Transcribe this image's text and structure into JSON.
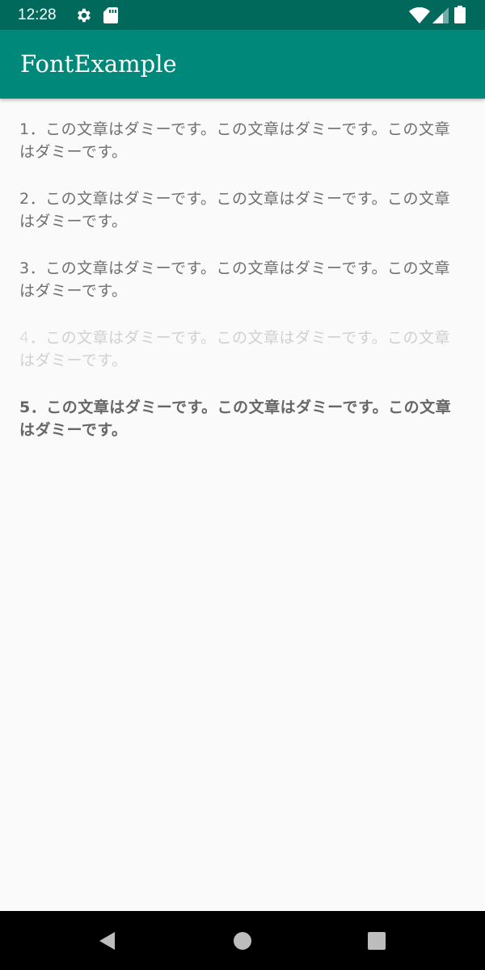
{
  "status_bar": {
    "time": "12:28",
    "icons": [
      "gear-icon",
      "sd-card-icon",
      "wifi-icon",
      "signal-icon",
      "battery-icon"
    ]
  },
  "app_bar": {
    "title": "FontExample",
    "color": "#00897b",
    "status_color": "#00695c"
  },
  "paragraphs": [
    {
      "text": "1．この文章はダミーです。この文章はダミーです。この文章はダミーです。",
      "color": "#6f6f6f"
    },
    {
      "text": "2．この文章はダミーです。この文章はダミーです。この文章はダミーです。",
      "color": "#6f6f6f"
    },
    {
      "text": "3．この文章はダミーです。この文章はダミーです。この文章はダミーです。",
      "color": "#6f6f6f"
    },
    {
      "text": "4．この文章はダミーです。この文章はダミーです。この文章はダミーです。",
      "color": "#d0d0d0"
    },
    {
      "text": "5．この文章はダミーです。この文章はダミーです。この文章はダミーです。",
      "color": "#666666"
    }
  ],
  "nav_bar": {
    "icons": [
      "back-icon",
      "home-icon",
      "recents-icon"
    ]
  }
}
